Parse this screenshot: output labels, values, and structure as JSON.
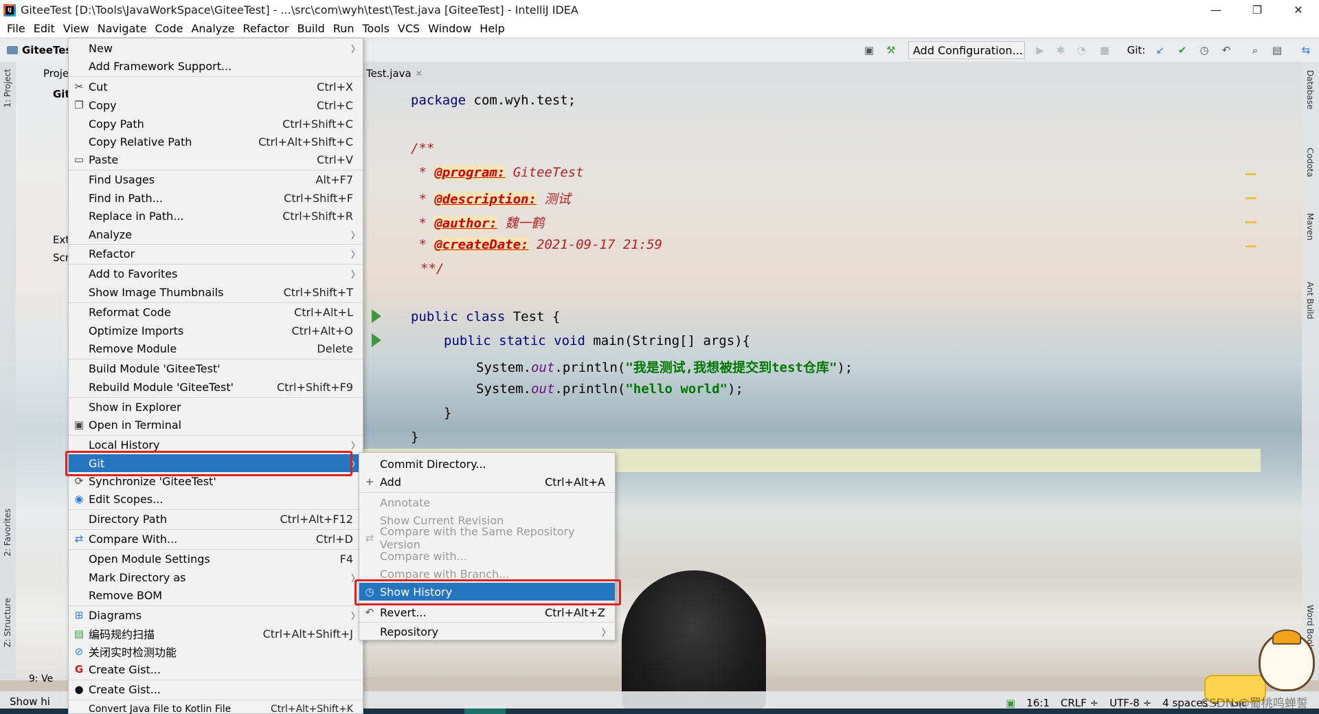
{
  "window": {
    "title": "GiteeTest [D:\\Tools\\JavaWorkSpace\\GiteeTest] - ...\\src\\com\\wyh\\test\\Test.java [GiteeTest] - IntelliJ IDEA",
    "logo_text": "IJ",
    "minimize": "—",
    "restore": "❐",
    "close": "✕"
  },
  "menubar": [
    "File",
    "Edit",
    "View",
    "Navigate",
    "Code",
    "Analyze",
    "Refactor",
    "Build",
    "Run",
    "Tools",
    "VCS",
    "Window",
    "Help"
  ],
  "navbar": {
    "project": "GiteeTes",
    "add_configuration": "Add Configuration...",
    "git_label": "Git:"
  },
  "left_tools": {
    "project": "1: Project",
    "favorites": "2: Favorites",
    "structure": "Z: Structure"
  },
  "right_tools": [
    "Database",
    "Codota",
    "Maven",
    "Ant Build",
    "Word Book"
  ],
  "project_panel": {
    "rows": [
      "Proje",
      "Git",
      "Ext",
      "Scr"
    ]
  },
  "editor": {
    "tab": "Test.java",
    "code": {
      "package_kw": "package",
      "package_name": " com.wyh.test;",
      "doc_open": "/**",
      "doc_close": "**/",
      "star": " * ",
      "program_tag": "@program:",
      "program_val": " GiteeTest",
      "description_tag": "@description:",
      "description_val": " 测试",
      "author_tag": "@author:",
      "author_val": " 魏一鹤",
      "createdate_tag": "@createDate:",
      "createdate_val": " 2021-09-17 21:59",
      "class_kw": "public class",
      "class_name": " Test {",
      "main_kw": "public static void",
      "main_rest": " main(String[] args){",
      "sys1_pre": "System.",
      "out": "out",
      "println_open": ".println(",
      "str1": "\"我是测试,我想被提交到test仓库\"",
      "close_semi": ");",
      "str2": "\"hello world\"",
      "brace_inner": "}",
      "brace_outer": "}"
    }
  },
  "status_bar": {
    "bottom_left_top": "9: Ve",
    "bottom_left": "Show hi",
    "position": "16:1",
    "line_sep": "CRLF ÷",
    "encoding": "UTF-8 ÷",
    "indent": "4 spaces ÷",
    "vcs": "Git",
    "watermark": "CSDN @蜀桃鸣蝉誓"
  },
  "context_menu": {
    "items": [
      {
        "label": "New",
        "shortcut": "",
        "submenu": true,
        "icon": ""
      },
      {
        "label": "Add Framework Support...",
        "shortcut": "",
        "submenu": false,
        "icon": ""
      },
      {
        "label": "Cut",
        "shortcut": "Ctrl+X",
        "submenu": false,
        "icon": "scissors-icon"
      },
      {
        "label": "Copy",
        "shortcut": "Ctrl+C",
        "submenu": false,
        "icon": "copy-icon"
      },
      {
        "label": "Copy Path",
        "shortcut": "Ctrl+Shift+C",
        "submenu": false,
        "icon": ""
      },
      {
        "label": "Copy Relative Path",
        "shortcut": "Ctrl+Alt+Shift+C",
        "submenu": false,
        "icon": ""
      },
      {
        "label": "Paste",
        "shortcut": "Ctrl+V",
        "submenu": false,
        "icon": "paste-icon"
      },
      {
        "label": "Find Usages",
        "shortcut": "Alt+F7",
        "submenu": false,
        "icon": ""
      },
      {
        "label": "Find in Path...",
        "shortcut": "Ctrl+Shift+F",
        "submenu": false,
        "icon": ""
      },
      {
        "label": "Replace in Path...",
        "shortcut": "Ctrl+Shift+R",
        "submenu": false,
        "icon": ""
      },
      {
        "label": "Analyze",
        "shortcut": "",
        "submenu": true,
        "icon": ""
      },
      {
        "label": "Refactor",
        "shortcut": "",
        "submenu": true,
        "icon": ""
      },
      {
        "label": "Add to Favorites",
        "shortcut": "",
        "submenu": true,
        "icon": ""
      },
      {
        "label": "Show Image Thumbnails",
        "shortcut": "Ctrl+Shift+T",
        "submenu": false,
        "icon": ""
      },
      {
        "label": "Reformat Code",
        "shortcut": "Ctrl+Alt+L",
        "submenu": false,
        "icon": ""
      },
      {
        "label": "Optimize Imports",
        "shortcut": "Ctrl+Alt+O",
        "submenu": false,
        "icon": ""
      },
      {
        "label": "Remove Module",
        "shortcut": "Delete",
        "submenu": false,
        "icon": ""
      },
      {
        "label": "Build Module 'GiteeTest'",
        "shortcut": "",
        "submenu": false,
        "icon": ""
      },
      {
        "label": "Rebuild Module 'GiteeTest'",
        "shortcut": "Ctrl+Shift+F9",
        "submenu": false,
        "icon": ""
      },
      {
        "label": "Show in Explorer",
        "shortcut": "",
        "submenu": false,
        "icon": ""
      },
      {
        "label": "Open in Terminal",
        "shortcut": "",
        "submenu": false,
        "icon": "terminal-icon"
      },
      {
        "label": "Local History",
        "shortcut": "",
        "submenu": true,
        "icon": ""
      },
      {
        "label": "Git",
        "shortcut": "",
        "submenu": true,
        "icon": ""
      },
      {
        "label": "Synchronize 'GiteeTest'",
        "shortcut": "",
        "submenu": false,
        "icon": "sync-icon"
      },
      {
        "label": "Edit Scopes...",
        "shortcut": "",
        "submenu": false,
        "icon": "scope-icon"
      },
      {
        "label": "Directory Path",
        "shortcut": "Ctrl+Alt+F12",
        "submenu": false,
        "icon": ""
      },
      {
        "label": "Compare With...",
        "shortcut": "Ctrl+D",
        "submenu": false,
        "icon": "compare-icon"
      },
      {
        "label": "Open Module Settings",
        "shortcut": "F4",
        "submenu": false,
        "icon": ""
      },
      {
        "label": "Mark Directory as",
        "shortcut": "",
        "submenu": true,
        "icon": ""
      },
      {
        "label": "Remove BOM",
        "shortcut": "",
        "submenu": false,
        "icon": ""
      },
      {
        "label": "Diagrams",
        "shortcut": "",
        "submenu": true,
        "icon": "diagram-icon"
      },
      {
        "label": "编码规约扫描",
        "shortcut": "Ctrl+Alt+Shift+J",
        "submenu": false,
        "icon": "scan-icon"
      },
      {
        "label": "关闭实时检测功能",
        "shortcut": "",
        "submenu": false,
        "icon": "disable-icon"
      },
      {
        "label": "Create Gist...",
        "shortcut": "",
        "submenu": false,
        "icon": "gitee-icon"
      },
      {
        "label": "Create Gist...",
        "shortcut": "",
        "submenu": false,
        "icon": "github-icon"
      },
      {
        "label": "Convert Java File to Kotlin File",
        "shortcut": "Ctrl+Alt+Shift+K",
        "submenu": false,
        "icon": ""
      }
    ]
  },
  "git_submenu": {
    "items": [
      {
        "label": "Commit Directory...",
        "shortcut": "",
        "disabled": false,
        "submenu": false,
        "icon": ""
      },
      {
        "label": "Add",
        "shortcut": "Ctrl+Alt+A",
        "disabled": false,
        "submenu": false,
        "icon": "plus-icon"
      },
      {
        "label": "Annotate",
        "shortcut": "",
        "disabled": true,
        "submenu": false,
        "icon": ""
      },
      {
        "label": "Show Current Revision",
        "shortcut": "",
        "disabled": true,
        "submenu": false,
        "icon": ""
      },
      {
        "label": "Compare with the Same Repository Version",
        "shortcut": "",
        "disabled": true,
        "submenu": false,
        "icon": "compare-icon"
      },
      {
        "label": "Compare with...",
        "shortcut": "",
        "disabled": true,
        "submenu": false,
        "icon": ""
      },
      {
        "label": "Compare with Branch...",
        "shortcut": "",
        "disabled": true,
        "submenu": false,
        "icon": ""
      },
      {
        "label": "Show History",
        "shortcut": "",
        "disabled": false,
        "submenu": false,
        "icon": "history-icon"
      },
      {
        "label": "Revert...",
        "shortcut": "Ctrl+Alt+Z",
        "disabled": false,
        "submenu": false,
        "icon": "revert-icon"
      },
      {
        "label": "Repository",
        "shortcut": "",
        "disabled": false,
        "submenu": true,
        "icon": ""
      }
    ]
  },
  "colors": {
    "selection": "#2675bf",
    "highlight_box": "#e0201c",
    "keyword": "#000080",
    "comment": "#b22222",
    "string": "#007700"
  }
}
